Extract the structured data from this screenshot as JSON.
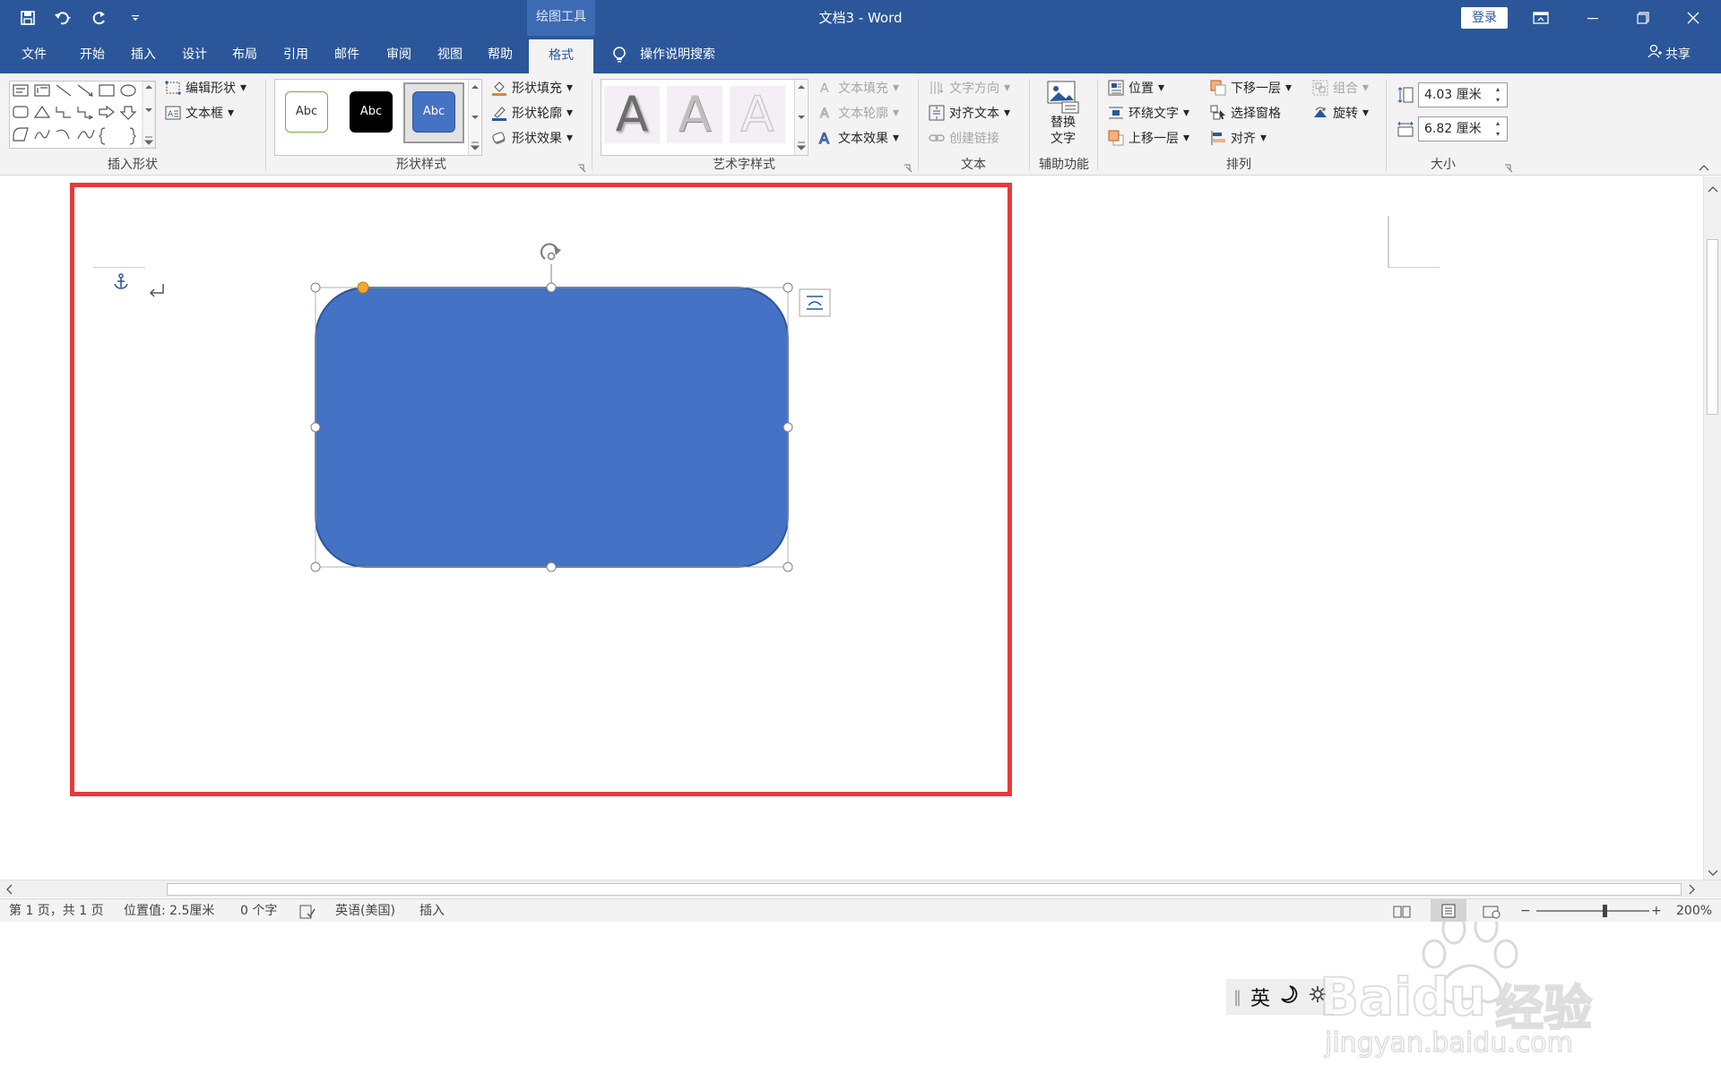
{
  "titlebar": {
    "doc_title": "文档3  -  Word",
    "tools_tab": "绘图工具",
    "login": "登录",
    "icons": [
      "save-icon",
      "undo-icon",
      "redo-icon",
      "customize-qat-icon",
      "ribbon-display-icon",
      "minimize-icon",
      "restore-icon",
      "close-icon"
    ]
  },
  "tabs": [
    {
      "label": "文件"
    },
    {
      "label": "开始"
    },
    {
      "label": "插入"
    },
    {
      "label": "设计"
    },
    {
      "label": "布局"
    },
    {
      "label": "引用"
    },
    {
      "label": "邮件"
    },
    {
      "label": "审阅"
    },
    {
      "label": "视图"
    },
    {
      "label": "帮助"
    },
    {
      "label": "格式"
    }
  ],
  "search": {
    "label": "操作说明搜索"
  },
  "share": {
    "label": "共享"
  },
  "ribbon": {
    "insert_shapes": {
      "label": "插入形状",
      "edit_shape": "编辑形状",
      "text_box": "文本框"
    },
    "shape_styles": {
      "label": "形状样式",
      "style_sample": "Abc",
      "fill": "形状填充",
      "outline": "形状轮廓",
      "effects": "形状效果"
    },
    "wordart": {
      "label": "艺术字样式",
      "sample": "A",
      "text_fill": "文本填充",
      "text_outline": "文本轮廓",
      "text_effects": "文本效果"
    },
    "text": {
      "label": "文本",
      "direction": "文字方向",
      "align": "对齐文本",
      "link": "创建链接"
    },
    "accessibility": {
      "label": "辅助功能",
      "alt_text_1": "替换",
      "alt_text_2": "文字"
    },
    "arrange": {
      "label": "排列",
      "position": "位置",
      "wrap": "环绕文字",
      "forward": "上移一层",
      "backward": "下移一层",
      "selection_pane": "选择窗格",
      "align": "对齐",
      "group": "组合",
      "rotate": "旋转"
    },
    "size": {
      "label": "大小",
      "height": "4.03 厘米",
      "width": "6.82 厘米"
    }
  },
  "document": {
    "shape_fill": "#4472c4",
    "shape_outline": "#2f5597",
    "highlight_color": "#e8393b",
    "ime_lang": "英"
  },
  "watermark": {
    "brand": "Baidu",
    "brand_cn": "经验",
    "url": "jingyan.baidu.com"
  },
  "status": {
    "page": "第 1 页，共 1 页",
    "position": "位置值: 2.5厘米",
    "words": "0 个字",
    "language": "英语(美国)",
    "mode": "插入",
    "zoom": "200%"
  }
}
